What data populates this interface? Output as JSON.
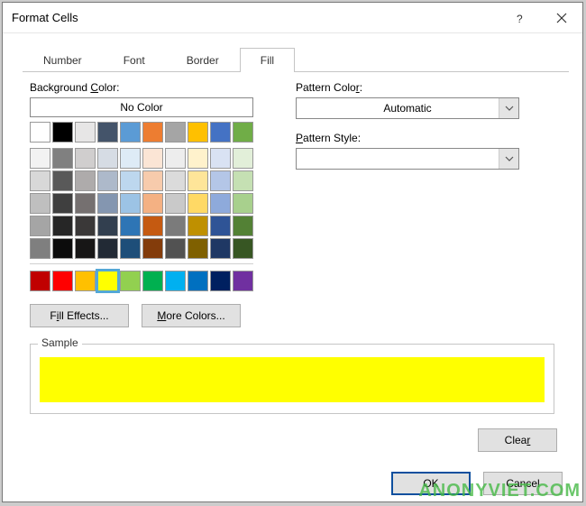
{
  "title": "Format Cells",
  "tabs": [
    "Number",
    "Font",
    "Border",
    "Fill"
  ],
  "activeTab": 3,
  "labels": {
    "bgcolor_pre": "Background ",
    "bgcolor_u": "C",
    "bgcolor_post": "olor:",
    "patcolor_pre": "Pattern Colo",
    "patcolor_u": "r",
    "patcolor_post": ":",
    "patstyle_pre": "",
    "patstyle_u": "P",
    "patstyle_post": "attern Style:"
  },
  "noColor": "No Color",
  "automatic": "Automatic",
  "fillEffects_pre": "F",
  "fillEffects_u": "i",
  "fillEffects_post": "ll Effects...",
  "moreColors_u": "M",
  "moreColors_post": "ore Colors...",
  "sample": "Sample",
  "clear": "Clea",
  "clear_u": "r",
  "ok": "OK",
  "cancel": "Cancel",
  "watermark": "ANONYVIET.COM",
  "selectedColor": "#ffff00",
  "themeRow1": [
    "#ffffff",
    "#000000",
    "#e7e6e6",
    "#44546a",
    "#5b9bd5",
    "#ed7d31",
    "#a5a5a5",
    "#ffc000",
    "#4472c4",
    "#70ad47"
  ],
  "themeShades": [
    [
      "#f2f2f2",
      "#808080",
      "#d0cece",
      "#d6dce4",
      "#deebf6",
      "#fbe5d5",
      "#ededed",
      "#fff2cc",
      "#d9e2f3",
      "#e2efd9"
    ],
    [
      "#d8d8d8",
      "#595959",
      "#aeabab",
      "#adb9ca",
      "#bdd7ee",
      "#f7cbac",
      "#dbdbdb",
      "#fee599",
      "#b4c6e7",
      "#c5e0b3"
    ],
    [
      "#bfbfbf",
      "#3f3f3f",
      "#757070",
      "#8496b0",
      "#9cc3e5",
      "#f4b183",
      "#c9c9c9",
      "#ffd965",
      "#8eaadb",
      "#a8d08d"
    ],
    [
      "#a5a5a5",
      "#262626",
      "#3a3838",
      "#323f4f",
      "#2e75b5",
      "#c55a11",
      "#7b7b7b",
      "#bf9000",
      "#2f5496",
      "#538135"
    ],
    [
      "#7f7f7f",
      "#0c0c0c",
      "#171616",
      "#222a35",
      "#1e4e79",
      "#833c0b",
      "#525252",
      "#7f6000",
      "#1f3864",
      "#375623"
    ]
  ],
  "standard": [
    "#c00000",
    "#ff0000",
    "#ffc000",
    "#ffff00",
    "#92d050",
    "#00b050",
    "#00b0f0",
    "#0070c0",
    "#002060",
    "#7030a0"
  ]
}
